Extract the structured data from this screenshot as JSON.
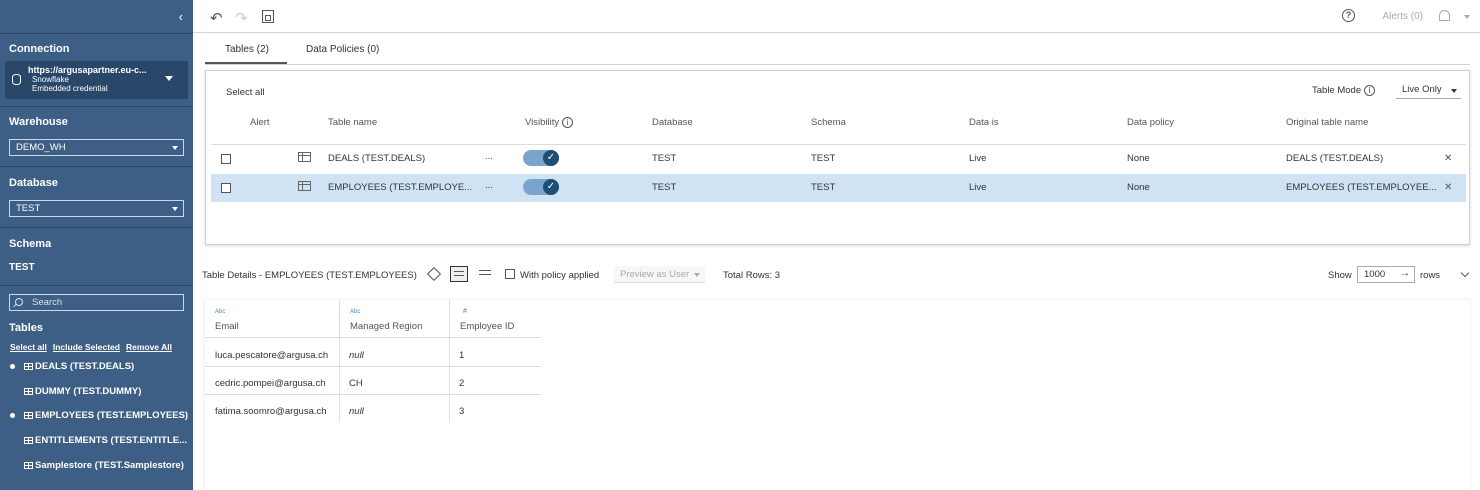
{
  "sidebar": {
    "connection_heading": "Connection",
    "connection": {
      "url": "https://argusapartner.eu-c...",
      "type": "Snowflake",
      "credential": "Embedded credential"
    },
    "warehouse_heading": "Warehouse",
    "warehouse_value": "DEMO_WH",
    "database_heading": "Database",
    "database_value": "TEST",
    "schema_heading": "Schema",
    "schema_value": "TEST",
    "search_placeholder": "Search",
    "tables_heading": "Tables",
    "links": {
      "select_all": "Select all",
      "include_selected": "Include Selected",
      "remove_all": "Remove All"
    },
    "tables": [
      {
        "label": "DEALS (TEST.DEALS)",
        "included": true
      },
      {
        "label": "DUMMY (TEST.DUMMY)",
        "included": false
      },
      {
        "label": "EMPLOYEES (TEST.EMPLOYEES)",
        "included": true
      },
      {
        "label": "ENTITLEMENTS (TEST.ENTITLE...",
        "included": false
      },
      {
        "label": "Samplestore (TEST.Samplestore)",
        "included": false
      }
    ]
  },
  "topbar": {
    "alerts_label": "Alerts (0)"
  },
  "tabs": [
    {
      "label": "Tables (2)",
      "active": true
    },
    {
      "label": "Data Policies (0)",
      "active": false
    }
  ],
  "tables_panel": {
    "select_all": "Select all",
    "table_mode_label": "Table Mode",
    "table_mode_value": "Live Only",
    "columns": {
      "alert": "Alert",
      "table_name": "Table name",
      "visibility": "Visibility",
      "database": "Database",
      "schema": "Schema",
      "data_is": "Data is",
      "data_policy": "Data policy",
      "original_table_name": "Original table name"
    },
    "more": "...",
    "rows": [
      {
        "table_name": "DEALS (TEST.DEALS)",
        "visible": true,
        "database": "TEST",
        "schema": "TEST",
        "data_is": "Live",
        "data_policy": "None",
        "original_table_name": "DEALS (TEST.DEALS)",
        "selected": false
      },
      {
        "table_name": "EMPLOYEES (TEST.EMPLOYE...",
        "visible": true,
        "database": "TEST",
        "schema": "TEST",
        "data_is": "Live",
        "data_policy": "None",
        "original_table_name": "EMPLOYEES (TEST.EMPLOYEE...",
        "selected": true
      }
    ]
  },
  "details": {
    "title": "Table Details - EMPLOYEES (TEST.EMPLOYEES)",
    "with_policy_label": "With policy applied",
    "preview_as_user": "Preview as User",
    "total_rows": "Total Rows: 3",
    "show_label": "Show",
    "rows_value": "1000",
    "rows_label": "rows"
  },
  "grid": {
    "type_abc": "Abc",
    "type_num": "#",
    "columns": [
      "Email",
      "Managed Region",
      "Employee ID"
    ],
    "rows": [
      [
        "luca.pescatore@argusa.ch",
        "null",
        "1"
      ],
      [
        "cedric.pompei@argusa.ch",
        "CH",
        "2"
      ],
      [
        "fatima.soomro@argusa.ch",
        "null",
        "3"
      ]
    ]
  },
  "colors": {
    "sidebar_bg": "#3d5f86",
    "selected_row": "#cfe3f5",
    "toggle_on": "#1c4e78"
  }
}
